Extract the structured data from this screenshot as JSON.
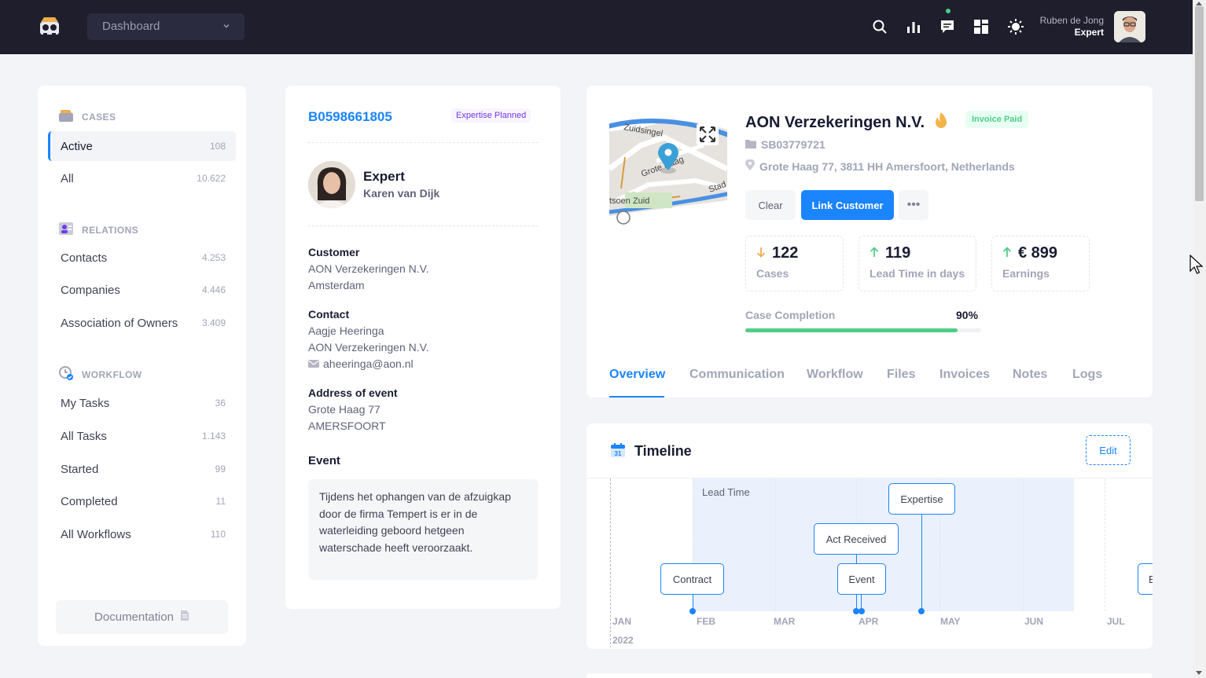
{
  "topbar": {
    "dashboard_select": "Dashboard",
    "icons": [
      "search-icon",
      "bar-chart-icon",
      "chat-icon",
      "layout-icon",
      "sun-icon"
    ],
    "user_name": "Ruben de Jong",
    "user_role": "Expert"
  },
  "sidebar": {
    "sections": [
      {
        "title": "CASES",
        "icon": "cases-icon"
      },
      {
        "title": "RELATIONS",
        "icon": "relations-icon"
      },
      {
        "title": "WORKFLOW",
        "icon": "workflow-icon"
      }
    ],
    "cases": [
      {
        "label": "Active",
        "count": "108"
      },
      {
        "label": "All",
        "count": "10.622"
      }
    ],
    "relations": [
      {
        "label": "Contacts",
        "count": "4.253"
      },
      {
        "label": "Companies",
        "count": "4.446"
      },
      {
        "label": "Association of Owners",
        "count": "3.409"
      }
    ],
    "workflow": [
      {
        "label": "My Tasks",
        "count": "36"
      },
      {
        "label": "All Tasks",
        "count": "1.143"
      },
      {
        "label": "Started",
        "count": "99"
      },
      {
        "label": "Completed",
        "count": "11"
      },
      {
        "label": "All Workflows",
        "count": "110"
      }
    ],
    "documentation": "Documentation"
  },
  "case": {
    "id": "B0598661805",
    "status": "Expertise Planned",
    "expert_title": "Expert",
    "expert_name": "Karen van Dijk",
    "customer_label": "Customer",
    "customer_name": "AON Verzekeringen N.V.",
    "customer_city": "Amsterdam",
    "contact_label": "Contact",
    "contact_name": "Aagje Heeringa",
    "contact_company": "AON Verzekeringen N.V.",
    "contact_email": "aheeringa@aon.nl",
    "address_label": "Address of event",
    "address_street": "Grote Haag 77",
    "address_city": "AMERSFOORT",
    "event_label": "Event",
    "event_text": "Tijdens het ophangen van de afzuigkap door de firma Tempert is er in de waterleiding geboord hetgeen waterschade heeft veroorzaakt."
  },
  "company": {
    "name": "AON Verzekeringen N.V.",
    "badge": "Invoice Paid",
    "ref": "SB03779721",
    "address": "Grote Haag 77, 3811 HH Amersfoort, Netherlands",
    "map_labels": [
      "Zuidsingel",
      "Grote Haag",
      "Stad",
      "tsoen Zuid"
    ],
    "btn_clear": "Clear",
    "btn_link": "Link Customer",
    "btn_more": "•••",
    "stats": [
      {
        "value": "122",
        "label": "Cases",
        "trend": "down"
      },
      {
        "value": "119",
        "label": "Lead Time in days",
        "trend": "up"
      },
      {
        "value": "€ 899",
        "label": "Earnings",
        "trend": "up"
      }
    ],
    "completion_label": "Case Completion",
    "completion_value": "90%",
    "completion_fraction": 0.9,
    "tabs": [
      "Overview",
      "Communication",
      "Workflow",
      "Files",
      "Invoices",
      "Notes",
      "Logs"
    ],
    "active_tab": "Overview"
  },
  "timeline": {
    "title": "Timeline",
    "calendar_day": "31",
    "edit": "Edit",
    "band_label": "Lead Time",
    "months": [
      "JAN",
      "FEB",
      "MAR",
      "APR",
      "MAY",
      "JUN",
      "JUL"
    ],
    "year": "2022",
    "events": [
      "Contract",
      "Event",
      "Act Received",
      "Expertise",
      "E"
    ]
  },
  "colors": {
    "primary": "#1b84ff",
    "success": "#50cd89",
    "topbar": "#1e1e2d",
    "purple": "#7239ea"
  }
}
